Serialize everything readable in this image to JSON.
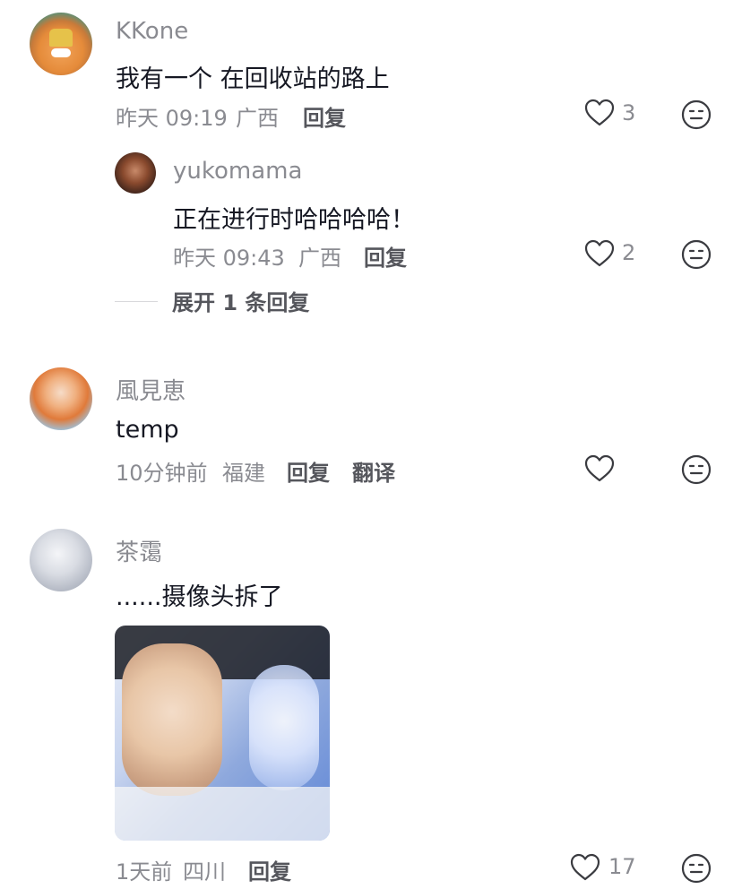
{
  "comments": [
    {
      "user": "KKone",
      "text": "我有一个 在回收站的路上",
      "time": "昨天 09:19",
      "location": "广西",
      "reply_label": "回复",
      "likes": "3",
      "reply": {
        "user": "yukomama",
        "text": "正在进行时哈哈哈哈！",
        "time": "昨天 09:43",
        "location": "广西",
        "reply_label": "回复",
        "likes": "2"
      },
      "expand_label": "展开 1 条回复"
    },
    {
      "user": "風見恵",
      "text": "temp",
      "time": "10分钟前",
      "location": "福建",
      "reply_label": "回复",
      "translate_label": "翻译"
    },
    {
      "user": "茶霭",
      "text": "......摄像头拆了",
      "time": "1天前",
      "location": "四川",
      "reply_label": "回复",
      "likes": "17"
    }
  ],
  "colors": {
    "name": "#8a8b91",
    "text": "#161823",
    "action": "#55565c"
  },
  "icons": {
    "like": "heart-outline-icon",
    "dislike": "neutral-face-icon"
  }
}
